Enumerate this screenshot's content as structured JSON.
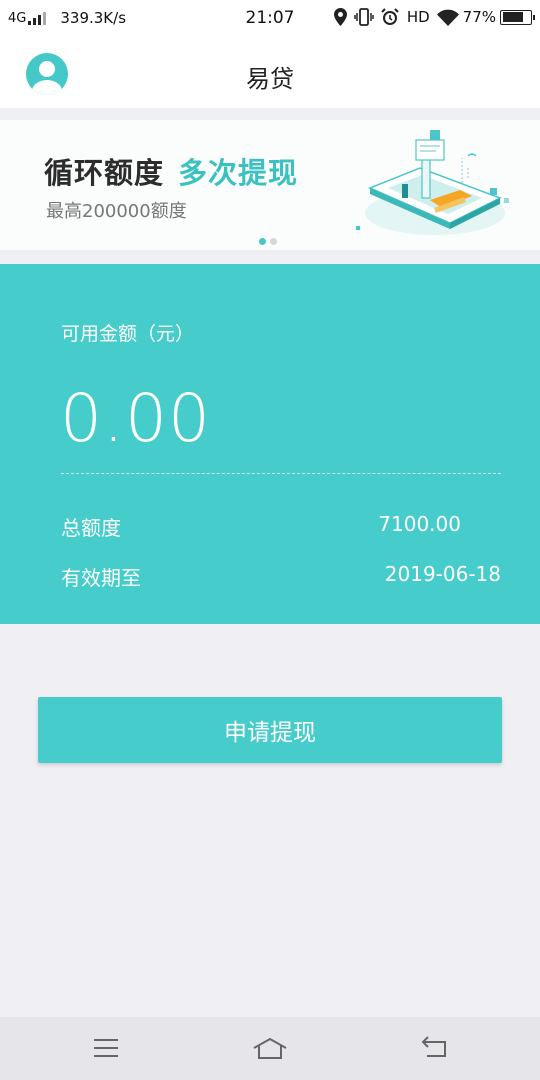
{
  "status_bar": {
    "network": "4G",
    "speed": "339.3K/s",
    "time": "21:07",
    "hd": "HD",
    "battery": "77%",
    "battery_level": 0.77
  },
  "header": {
    "title": "易贷"
  },
  "banner": {
    "title_main": "循环额度",
    "title_accent": "多次提现",
    "subtitle": "最高200000额度",
    "accent_color": "#3cc1c1",
    "active_slide": 1,
    "slide_count": 2
  },
  "credit": {
    "available_label": "可用金额（元）",
    "available_amount": "0.00",
    "total_label": "总额度",
    "total_value": "7100.00",
    "expire_label": "有效期至",
    "expire_value": "2019-06-18",
    "bg_color": "#46cccb"
  },
  "action": {
    "withdraw_label": "申请提现"
  },
  "nav": {
    "icons": [
      "menu-icon",
      "home-icon",
      "back-icon"
    ]
  }
}
